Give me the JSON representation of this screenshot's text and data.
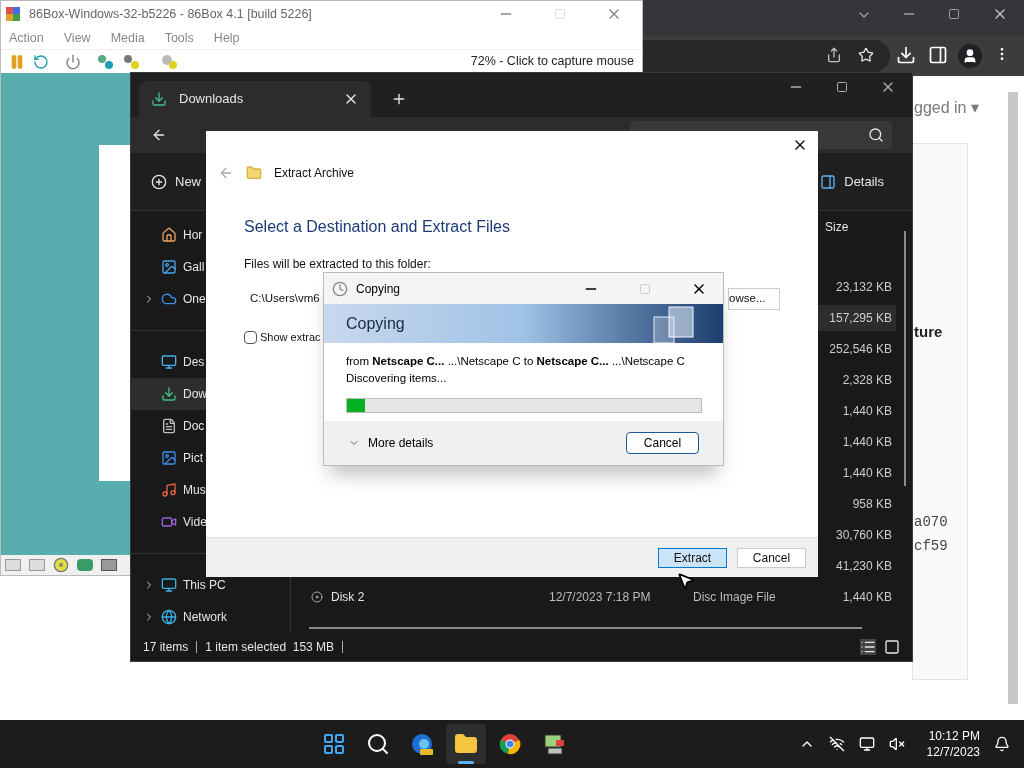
{
  "browser": {
    "account_menu": "gged in ▾",
    "fragment_bold": "ture",
    "fragment_code": [
      "a070",
      "cf59"
    ]
  },
  "emulator": {
    "title": "86Box-Windows-32-b5226 - 86Box 4.1 [build 5226]",
    "menu": [
      "Action",
      "View",
      "Media",
      "Tools",
      "Help"
    ],
    "status": "72% - Click to capture mouse"
  },
  "explorer": {
    "tab": "Downloads",
    "new_button": "New",
    "details_button": "Details",
    "sidebar": [
      {
        "kind": "home",
        "label": "Hor",
        "expandable": false,
        "selected": false
      },
      {
        "kind": "gallery",
        "label": "Gall",
        "expandable": false,
        "selected": false
      },
      {
        "kind": "cloud",
        "label": "One",
        "expandable": true,
        "selected": false
      },
      {
        "kind": "divider"
      },
      {
        "kind": "desktop",
        "label": "Des",
        "expandable": false,
        "selected": false
      },
      {
        "kind": "downloads",
        "label": "Dow",
        "expandable": false,
        "selected": true
      },
      {
        "kind": "documents",
        "label": "Doc",
        "expandable": false,
        "selected": false
      },
      {
        "kind": "pictures",
        "label": "Pict",
        "expandable": false,
        "selected": false
      },
      {
        "kind": "music",
        "label": "Mus",
        "expandable": false,
        "selected": false
      },
      {
        "kind": "videos",
        "label": "Vide",
        "expandable": false,
        "selected": false
      },
      {
        "kind": "divider"
      },
      {
        "kind": "pc",
        "label": "This PC",
        "expandable": true,
        "selected": false
      },
      {
        "kind": "network",
        "label": "Network",
        "expandable": true,
        "selected": false
      }
    ],
    "size_header": "Size",
    "files": [
      {
        "size": "23,132 KB",
        "selected": false
      },
      {
        "size": "157,295 KB",
        "selected": true
      },
      {
        "size": "252,546 KB",
        "selected": false
      },
      {
        "size": "2,328 KB",
        "selected": false
      },
      {
        "size": "1,440 KB",
        "selected": false
      },
      {
        "size": "1,440 KB",
        "selected": false
      },
      {
        "size": "1,440 KB",
        "selected": false
      },
      {
        "size": "958 KB",
        "selected": false
      },
      {
        "size": "30,760 KB",
        "selected": false
      },
      {
        "size": "41,230 KB",
        "selected": false
      },
      {
        "name": "Disk 2",
        "date": "12/7/2023 7:18 PM",
        "type": "Disc Image File",
        "size": "1,440 KB",
        "selected": false
      }
    ],
    "status_items": "17 items",
    "status_selection": "1 item selected  153 MB"
  },
  "extract_dialog": {
    "title": "Extract Archive",
    "heading": "Select a Destination and Extract Files",
    "folder_label": "Files will be extracted to this folder:",
    "path": "C:\\Users\\vm6",
    "browse": "owse...",
    "show_files": {
      "label": "Show extrac",
      "checked": false
    },
    "buttons": [
      {
        "label": "Extract",
        "default": true
      },
      {
        "label": "Cancel",
        "default": false
      }
    ]
  },
  "copy_dialog": {
    "title": "Copying",
    "header": "Copying",
    "from_text": "from **Netscape C...** ...\\Netscape C to **Netscape C...** ...\\Netscape C",
    "status": "Discovering items...",
    "level": 0.05,
    "more": "More details",
    "cancel": "Cancel"
  },
  "taskbar": {
    "apps": [
      {
        "kind": "start",
        "selected": false
      },
      {
        "kind": "search",
        "selected": false
      },
      {
        "kind": "edge",
        "selected": false
      },
      {
        "kind": "files",
        "selected": true
      },
      {
        "kind": "chrome",
        "selected": false
      },
      {
        "kind": "emulator",
        "selected": false
      }
    ],
    "time": "10:12 PM",
    "date": "12/7/2023"
  }
}
